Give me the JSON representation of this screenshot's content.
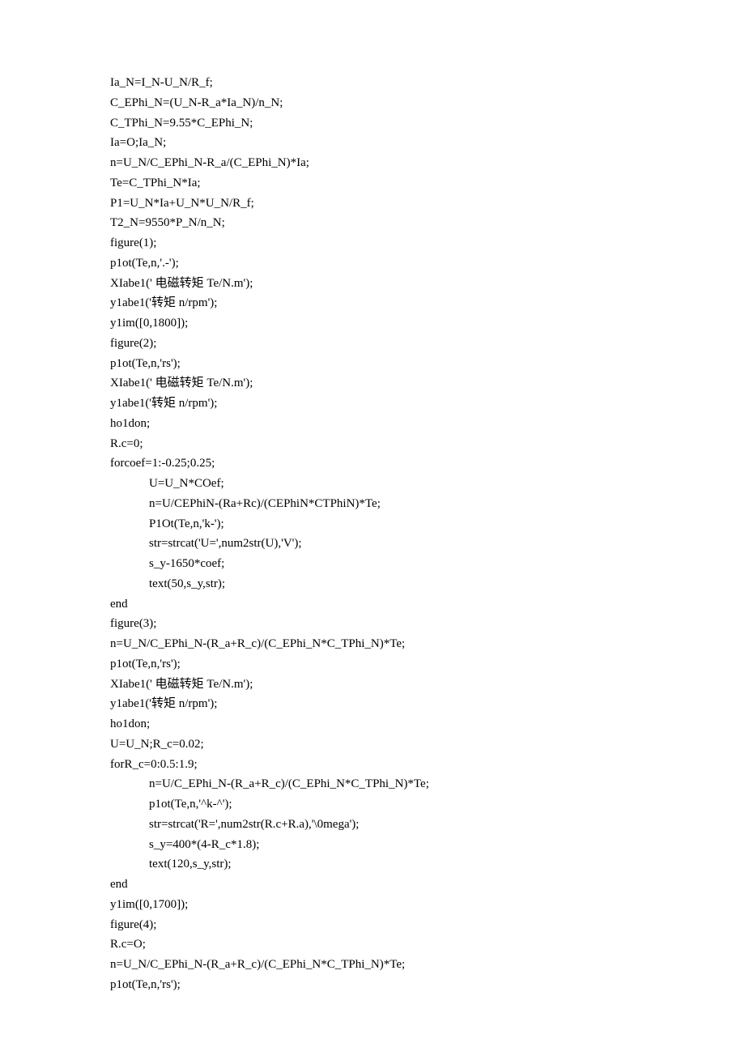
{
  "lines": [
    "Ia_N=I_N-U_N/R_f;",
    "C_EPhi_N=(U_N-R_a*Ia_N)/n_N;",
    "C_TPhi_N=9.55*C_EPhi_N;",
    "Ia=O;Ia_N;",
    "n=U_N/C_EPhi_N-R_a/(C_EPhi_N)*Ia;",
    "Te=C_TPhi_N*Ia;",
    "P1=U_N*Ia+U_N*U_N/R_f;",
    "T2_N=9550*P_N/n_N;",
    "figure(1);",
    "p1ot(Te,n,'.-');",
    "XIabe1(' 电磁转矩 Te/N.m');",
    "y1abe1('转矩 n/rpm');",
    "y1im([0,1800]);",
    "figure(2);",
    "p1ot(Te,n,'rs');",
    "XIabe1(' 电磁转矩 Te/N.m');",
    "y1abe1('转矩 n/rpm');",
    "ho1don;",
    "R.c=0;",
    "forcoef=1:-0.25;0.25;",
    "U=U_N*COef;",
    "n=U/CEPhiN-(Ra+Rc)/(CEPhiN*CTPhiN)*Te;",
    "P1Ot(Te,n,'k-');",
    "str=strcat('U=',num2str(U),'V');",
    "s_y-1650*coef;",
    "text(50,s_y,str);",
    "end",
    "figure(3);",
    "n=U_N/C_EPhi_N-(R_a+R_c)/(C_EPhi_N*C_TPhi_N)*Te;",
    "p1ot(Te,n,'rs');",
    "XIabe1(' 电磁转矩 Te/N.m');",
    "y1abe1('转矩 n/rpm');",
    "ho1don;",
    "U=U_N;R_c=0.02;",
    "forR_c=0:0.5:1.9;",
    "n=U/C_EPhi_N-(R_a+R_c)/(C_EPhi_N*C_TPhi_N)*Te;",
    "p1ot(Te,n,'^k-^');",
    "str=strcat('R=',num2str(R.c+R.a),'\\0mega');",
    "s_y=400*(4-R_c*1.8);",
    "text(120,s_y,str);",
    "end",
    "y1im([0,1700]);",
    "figure(4);",
    "R.c=O;",
    "n=U_N/C_EPhi_N-(R_a+R_c)/(C_EPhi_N*C_TPhi_N)*Te;",
    "p1ot(Te,n,'rs');"
  ],
  "indented": [
    20,
    21,
    22,
    23,
    24,
    25,
    35,
    36,
    37,
    38,
    39
  ]
}
